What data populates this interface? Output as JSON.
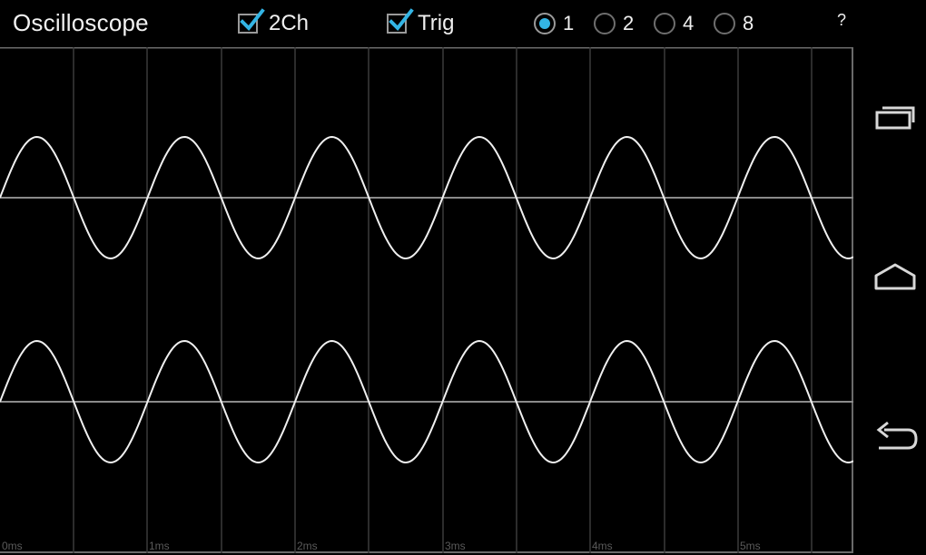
{
  "app": {
    "title": "Oscilloscope",
    "checkbox_2ch": {
      "label": "2Ch",
      "checked": true
    },
    "checkbox_trig": {
      "label": "Trig",
      "checked": true
    },
    "radio_options": [
      {
        "label": "1",
        "selected": true
      },
      {
        "label": "2",
        "selected": false
      },
      {
        "label": "4",
        "selected": false
      },
      {
        "label": "8",
        "selected": false
      }
    ],
    "help_label": "?"
  },
  "scope": {
    "background": "#000000",
    "grid_color": "#3a3a3a",
    "baseline_color": "#8a8a8a",
    "trace_color": "#f0f0f0",
    "time_labels": [
      "0ms",
      "1ms",
      "2ms",
      "3ms",
      "4ms",
      "5ms"
    ]
  },
  "nav": {
    "icons": [
      "recent-apps-icon",
      "home-icon",
      "back-icon"
    ]
  },
  "colors": {
    "accent": "#33b5e5",
    "text": "#f0f0f0"
  }
}
